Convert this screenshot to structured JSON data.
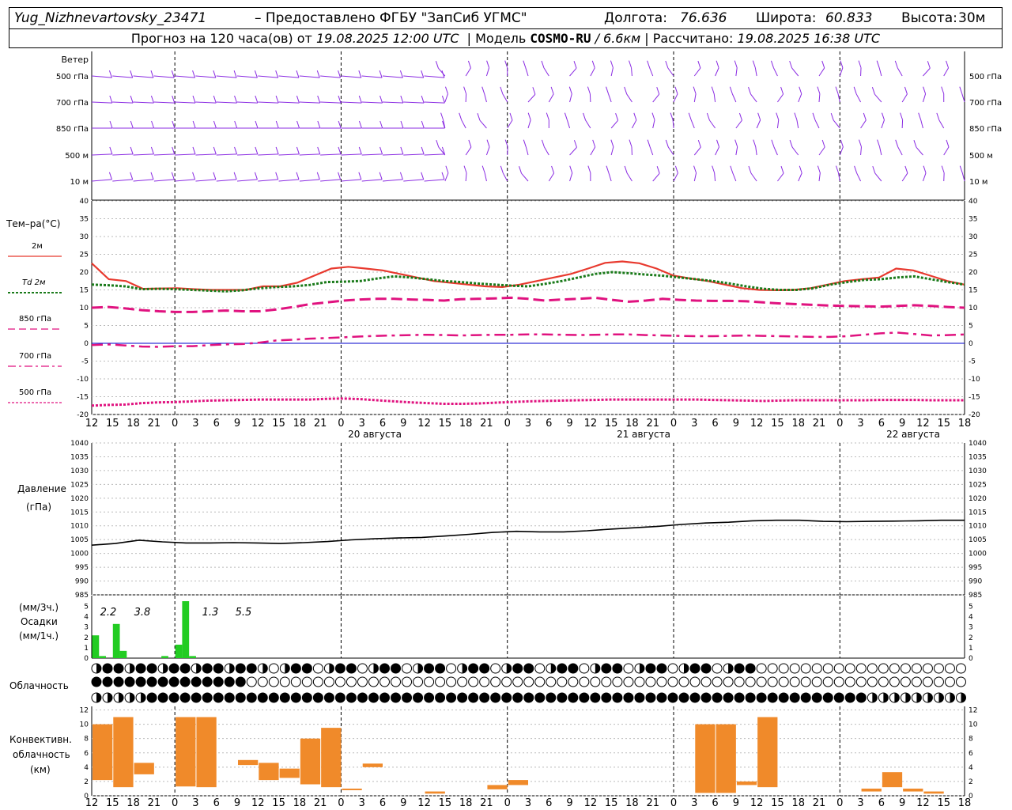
{
  "header": {
    "station": "Yug_Nizhnevartovsky_23471",
    "provided_by": "– Предоставлено ФГБУ \"ЗапСиб УГМС\"",
    "lon_label": "Долгота:",
    "lon_value": "76.636",
    "lat_label": "Широта:",
    "lat_value": "60.833",
    "alt_label": "Высота:",
    "alt_value": "30м",
    "forecast_label": "Прогноз на 120 часа(ов) от",
    "forecast_start": "19.08.2025 12:00 UTC",
    "model_label": "Модель",
    "model_name": "COSMO-RU",
    "model_res": "/ 6.6км",
    "computed_label": "Рассчитано:",
    "computed_time": "19.08.2025 16:38 UTC"
  },
  "x_ticks": [
    "12",
    "15",
    "18",
    "21",
    "0",
    "3",
    "6",
    "9",
    "12",
    "15",
    "18",
    "21",
    "0",
    "3",
    "6",
    "9",
    "12",
    "15",
    "18",
    "21",
    "0",
    "3",
    "6",
    "9",
    "12",
    "15",
    "18"
  ],
  "date_labels": [
    "20 августа",
    "21 августа",
    "22 августа"
  ],
  "colors": {
    "t2m": "#e8392e",
    "td2m": "#1a7a1a",
    "t_levels": "#e0127f",
    "wind": "#8a2be2",
    "precip": "#22cc22",
    "conv": "#f08a2a",
    "pressure": "#000000",
    "zero_line": "#0000cc"
  },
  "wind_panel": {
    "title": "Ветер",
    "levels": [
      "500 гПа",
      "700 гПа",
      "850 гПа",
      "500 м",
      "10 м"
    ]
  },
  "temp_panel": {
    "title": "Тем–ра(°C)",
    "legend": [
      "2м",
      "Td 2м",
      "850 гПа",
      "700 гПа",
      "500 гПа"
    ],
    "y_ticks": [
      "40",
      "35",
      "30",
      "25",
      "20",
      "15",
      "10",
      "5",
      "0",
      "-5",
      "-10",
      "-15",
      "-20"
    ]
  },
  "pressure_panel": {
    "title": "Давление",
    "unit": "(гПа)",
    "y_ticks": [
      "1040",
      "1035",
      "1030",
      "1025",
      "1020",
      "1015",
      "1010",
      "1005",
      "1000",
      "995",
      "990",
      "985"
    ]
  },
  "precip_panel": {
    "unit_top": "(мм/3ч.)",
    "title": "Осадки",
    "unit_bottom": "(мм/1ч.)",
    "y_ticks": [
      "5",
      "4",
      "3",
      "2",
      "1",
      "0"
    ],
    "totals": [
      "2.2",
      "3.8",
      "1.3",
      "5.5"
    ]
  },
  "cloud_panel": {
    "title": "Облачность"
  },
  "conv_panel": {
    "title_1": "Конвективн.",
    "title_2": "облачность",
    "unit": "(км)",
    "y_ticks": [
      "12",
      "10",
      "8",
      "6",
      "4",
      "2",
      "0"
    ]
  },
  "chart_data": {
    "type": "line",
    "x_hours": [
      0,
      3,
      6,
      9,
      12,
      15,
      18,
      21,
      24,
      27,
      30,
      33,
      36,
      39,
      42,
      45,
      48,
      51,
      54,
      57,
      60,
      63,
      66,
      69,
      72,
      75,
      78,
      81,
      84,
      87,
      90,
      93,
      96,
      99,
      102,
      105,
      108,
      111,
      114,
      117,
      120
    ],
    "series": [
      {
        "name": "2м",
        "values": [
          22.5,
          18,
          17.5,
          15.3,
          15.4,
          15.5,
          15.2,
          15,
          15,
          15,
          16,
          16,
          17,
          19,
          21,
          21.5,
          21,
          20.5,
          19.5,
          18.5,
          17.5,
          17,
          16.5,
          16,
          15.8,
          16.5,
          17.5,
          18.5,
          19.5,
          21,
          22.6,
          23,
          22.5,
          21,
          19,
          18.2,
          17.5,
          16.5,
          15.5,
          15,
          14.9,
          15,
          15.5,
          16.5,
          17.5,
          18,
          18.5,
          21,
          20.5,
          19,
          17.5,
          16.5
        ]
      },
      {
        "name": "Td 2м",
        "values": [
          16.5,
          16.3,
          16,
          15.2,
          15.3,
          15.2,
          15,
          14.8,
          14.6,
          14.9,
          15.5,
          15.8,
          16,
          16.4,
          17.2,
          17.3,
          17.5,
          18.2,
          18.8,
          18.5,
          18,
          17.5,
          17.2,
          16.8,
          16.5,
          16.2,
          16,
          16.7,
          17.5,
          18.5,
          19.5,
          20,
          19.7,
          19.3,
          19,
          18.5,
          18,
          17.5,
          16.8,
          16,
          15.3,
          15,
          15,
          15.5,
          16.5,
          17.2,
          17.8,
          18,
          18.5,
          18.8,
          18,
          17.2,
          16.5
        ]
      },
      {
        "name": "850 гПа",
        "values": [
          10,
          10.2,
          9.8,
          9.3,
          9,
          8.8,
          8.8,
          9,
          9.2,
          9,
          9,
          9.5,
          10.2,
          11,
          11.5,
          12,
          12.3,
          12.5,
          12.5,
          12.3,
          12.2,
          12,
          12.4,
          12.5,
          12.6,
          12.8,
          12.5,
          12,
          12.3,
          12.5,
          12.8,
          12.2,
          11.7,
          12,
          12.5,
          12.2,
          12,
          11.9,
          11.9,
          11.8,
          11.5,
          11.2,
          11,
          10.8,
          10.6,
          10.5,
          10.4,
          10.3,
          10.5,
          10.7,
          10.5,
          10.2,
          10
        ]
      },
      {
        "name": "700 гПа",
        "values": [
          -0.5,
          -0.3,
          -0.6,
          -0.9,
          -1,
          -0.8,
          -0.8,
          -0.5,
          -0.3,
          -0.2,
          0.2,
          0.8,
          1,
          1.3,
          1.5,
          1.7,
          1.9,
          2.1,
          2.2,
          2.3,
          2.4,
          2.3,
          2.2,
          2.3,
          2.4,
          2.4,
          2.5,
          2.5,
          2.4,
          2.3,
          2.4,
          2.5,
          2.5,
          2.3,
          2.2,
          2.1,
          2,
          2,
          2.1,
          2.2,
          2.1,
          2,
          1.9,
          1.8,
          1.8,
          2,
          2.4,
          2.8,
          3,
          2.6,
          2.2,
          2.3,
          2.5
        ]
      },
      {
        "name": "500 гПа",
        "values": [
          -17.5,
          -17.3,
          -17.2,
          -16.8,
          -16.6,
          -16.5,
          -16.3,
          -16.1,
          -16,
          -15.9,
          -15.8,
          -15.8,
          -15.8,
          -15.8,
          -15.6,
          -15.5,
          -15.7,
          -16,
          -16.3,
          -16.6,
          -16.8,
          -17,
          -17,
          -16.9,
          -16.7,
          -16.5,
          -16.3,
          -16.2,
          -16.1,
          -16,
          -15.9,
          -15.8,
          -15.8,
          -15.8,
          -15.8,
          -15.8,
          -15.8,
          -15.9,
          -16,
          -16.1,
          -16.2,
          -16.1,
          -16,
          -16,
          -16,
          -16,
          -16,
          -15.9,
          -15.9,
          -15.9,
          -16,
          -16,
          -16
        ]
      }
    ],
    "pressure_hPa": [
      1003,
      1003.6,
      1004.8,
      1004.2,
      1003.8,
      1003.8,
      1003.9,
      1003.8,
      1003.6,
      1003.9,
      1004.3,
      1004.9,
      1005.3,
      1005.6,
      1005.8,
      1006.3,
      1006.9,
      1007.6,
      1008,
      1007.8,
      1007.8,
      1008.2,
      1008.8,
      1009.3,
      1009.8,
      1010.5,
      1011,
      1011.3,
      1011.8,
      1012,
      1012,
      1011.6,
      1011.5,
      1011.6,
      1011.7,
      1011.8,
      1012,
      1012
    ],
    "precip_mm_1h": [
      2.2,
      0.2,
      0,
      3.3,
      0.7,
      0,
      0,
      0,
      0,
      0,
      0.2,
      0,
      1.3,
      5.5,
      0.2
    ],
    "precip_3h_totals": [
      2.2,
      3.8,
      1.3,
      5.5
    ],
    "conv_cloud_km": [
      {
        "h": 0,
        "base": 2.2,
        "top": 10
      },
      {
        "h": 1,
        "base": 1.2,
        "top": 11
      },
      {
        "h": 2,
        "base": 3,
        "top": 4.6
      },
      {
        "h": 4,
        "base": 1.3,
        "top": 11
      },
      {
        "h": 5,
        "base": 1.2,
        "top": 11
      },
      {
        "h": 7,
        "base": 4.3,
        "top": 5
      },
      {
        "h": 8,
        "base": 2.2,
        "top": 4.6
      },
      {
        "h": 9,
        "base": 2.5,
        "top": 3.8
      },
      {
        "h": 10,
        "base": 1.6,
        "top": 8
      },
      {
        "h": 11,
        "base": 1.2,
        "top": 9.5
      },
      {
        "h": 12,
        "base": 1,
        "top": 1
      },
      {
        "h": 13,
        "base": 4,
        "top": 4.5
      },
      {
        "h": 16,
        "base": 0.3,
        "top": 0.6
      },
      {
        "h": 19,
        "base": 0.9,
        "top": 1.5
      },
      {
        "h": 20,
        "base": 1.5,
        "top": 2.2
      },
      {
        "h": 29,
        "base": 0.4,
        "top": 10
      },
      {
        "h": 30,
        "base": 0.4,
        "top": 10
      },
      {
        "h": 31,
        "base": 1.5,
        "top": 2
      },
      {
        "h": 32,
        "base": 1.2,
        "top": 11
      },
      {
        "h": 37,
        "base": 0.6,
        "top": 1
      },
      {
        "h": 38,
        "base": 1.2,
        "top": 3.3
      },
      {
        "h": 39,
        "base": 0.6,
        "top": 1
      },
      {
        "h": 40,
        "base": 0.3,
        "top": 0.6
      }
    ],
    "ylim_temp": [
      -20,
      40
    ],
    "ylim_pressure": [
      985,
      1040
    ],
    "ylim_precip": [
      0,
      5
    ],
    "ylim_conv": [
      0,
      12
    ]
  }
}
